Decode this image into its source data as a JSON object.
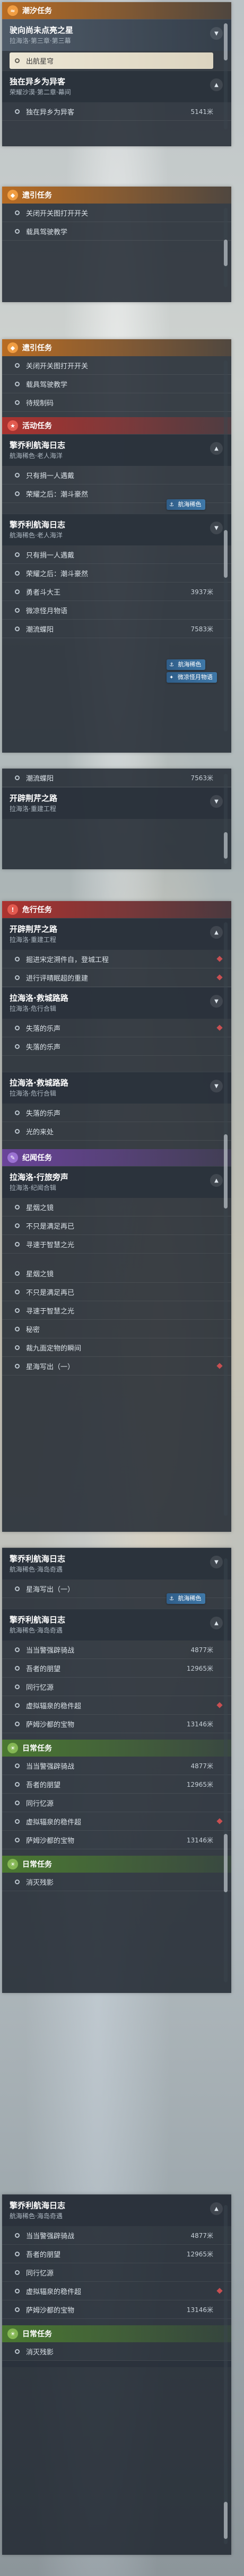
{
  "sections": {
    "chaoxi": "潮汐任务",
    "ditui": "遗引任务",
    "huodong": "活动任务",
    "weixing": "危行任务",
    "jiming": "纪闻任务",
    "richang": "日常任务"
  },
  "quests": {
    "yingxiang": {
      "title": "驶向尚未点亮之星",
      "sub": "拉海洛·第三章·第三幕",
      "goal": "出航星穹"
    },
    "duzai": {
      "title": "独在异乡为异客",
      "sub": "荣耀沙漠·第二章·幕间",
      "goal": "独在异乡为异客",
      "dist": "5141米"
    },
    "qinhang": {
      "title": "擎乔利航海日志",
      "sub": "航海稀色·老人海洋"
    },
    "kaipi": {
      "title": "开辟荆芹之路",
      "sub": "拉海洛·重建工程"
    },
    "lahailuo_ganran": {
      "title": "拉海洛·救城路路",
      "sub": "拉海洛·危行合辑"
    },
    "lahailuo_xinggu": {
      "title": "拉海洛·行旅旁声",
      "sub": "拉海洛·纪闻合辑"
    },
    "qinhang2": {
      "title": "擎乔利航海日志",
      "sub": "航海稀色·海岛奇遇"
    }
  },
  "items": {
    "guanbi": "关闭开关图打开开关",
    "jiaoxue": "载具驾驶教学",
    "duanji": "待规制码",
    "youjiang": "只有捐一人遇戴",
    "rongyao": "荣耀之后：潮斗豪然",
    "qingdou": "勇者斗大王",
    "weixiao": "微凉怪月物语",
    "chaoliu": "潮流蝶阳",
    "chaoliu_dist": "7583米",
    "chaoliu2_dist": "7563米",
    "zhanglu": "掘进宋定溯件自，登城工程",
    "jinru": "进行评晴眠超的重建",
    "shimeng": "失落的乐声",
    "guang": "光的来处",
    "xing": "星烟之镜",
    "bukefu": "不只是满足再已",
    "xunzhe": "寻速于智慧之光",
    "mima": "秘密",
    "qiyuan": "裁九面定物的瞬间",
    "xinghai": "星海写出（一）",
    "dangdang": "当当警强辟骑战",
    "dangdang_dist": "4877米",
    "qiezhe": "吾者的朋望",
    "qiezhe_dist": "12965米",
    "tongxing": "同行忆源",
    "xuwei": "虚拟辐泉的稳件超",
    "sahui": "萨姆沙都的宝物",
    "sahui_dist": "13146米",
    "xiaojian": "消灭残影",
    "qingdou_dist": "3937米"
  },
  "badges": {
    "hanghai": "航海稀色",
    "baoluo": "航海稀色",
    "weixiao_tag": "微凉怪月物语"
  }
}
